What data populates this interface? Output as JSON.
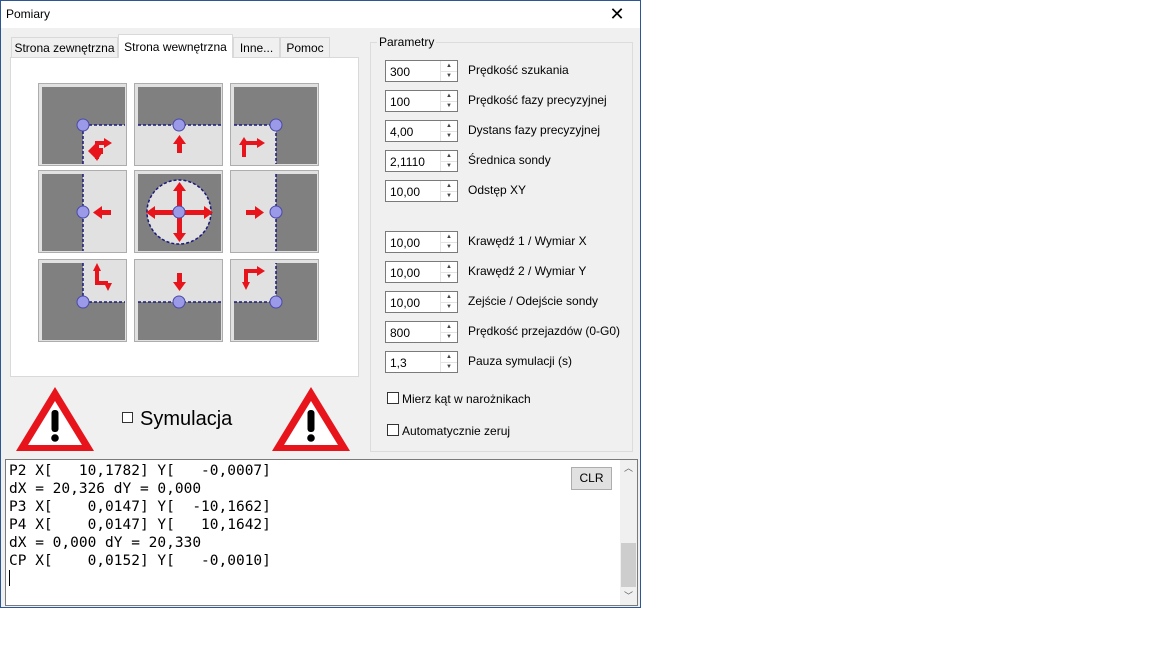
{
  "window": {
    "title": "Pomiary",
    "close_icon": "close-icon"
  },
  "tabs": [
    {
      "label": "Strona zewnętrzna",
      "active": false
    },
    {
      "label": "Strona wewnętrzna",
      "active": true
    },
    {
      "label": "Inne...",
      "active": false
    },
    {
      "label": "Pomoc",
      "active": false
    }
  ],
  "probe_buttons": [
    "probe-top-left-corner",
    "probe-top-edge",
    "probe-top-right-corner",
    "probe-left-edge",
    "probe-center-bore",
    "probe-right-edge",
    "probe-bottom-left-corner",
    "probe-bottom-edge",
    "probe-bottom-right-corner"
  ],
  "simulation": {
    "label": "Symulacja",
    "checked": false,
    "warning_icon": "warning-triangle-icon"
  },
  "params": {
    "group_title": "Parametry",
    "fields": [
      {
        "value": "300",
        "label": "Prędkość szukania"
      },
      {
        "value": "100",
        "label": "Prędkość fazy precyzyjnej"
      },
      {
        "value": "4,00",
        "label": "Dystans fazy precyzyjnej"
      },
      {
        "value": "2,1110",
        "label": "Średnica sondy"
      },
      {
        "value": "10,00",
        "label": "Odstęp XY"
      },
      {
        "value": "10,00",
        "label": "Krawędź 1 / Wymiar X"
      },
      {
        "value": "10,00",
        "label": "Krawędź 2 / Wymiar Y"
      },
      {
        "value": "10,00",
        "label": "Zejście / Odejście sondy"
      },
      {
        "value": "800",
        "label": "Prędkość przejazdów (0-G0)"
      },
      {
        "value": "1,3",
        "label": "Pauza symulacji (s)"
      }
    ],
    "checkboxes": [
      {
        "label": "Mierz kąt w narożnikach",
        "checked": false
      },
      {
        "label": "Automatycznie zeruj",
        "checked": false
      }
    ]
  },
  "log": {
    "lines": [
      "P2 X[   10,1782] Y[   -0,0007]",
      "dX = 20,326 dY = 0,000",
      "P3 X[    0,0147] Y[  -10,1662]",
      "P4 X[    0,0147] Y[   10,1642]",
      "dX = 0,000 dY = 20,330",
      "CP X[    0,0152] Y[   -0,0010]"
    ],
    "clr_label": "CLR"
  },
  "colors": {
    "accent_red": "#e8141b",
    "probe_ball": "#8f8fe0",
    "gray_block": "#808080",
    "light_area": "#e1e1e1"
  }
}
